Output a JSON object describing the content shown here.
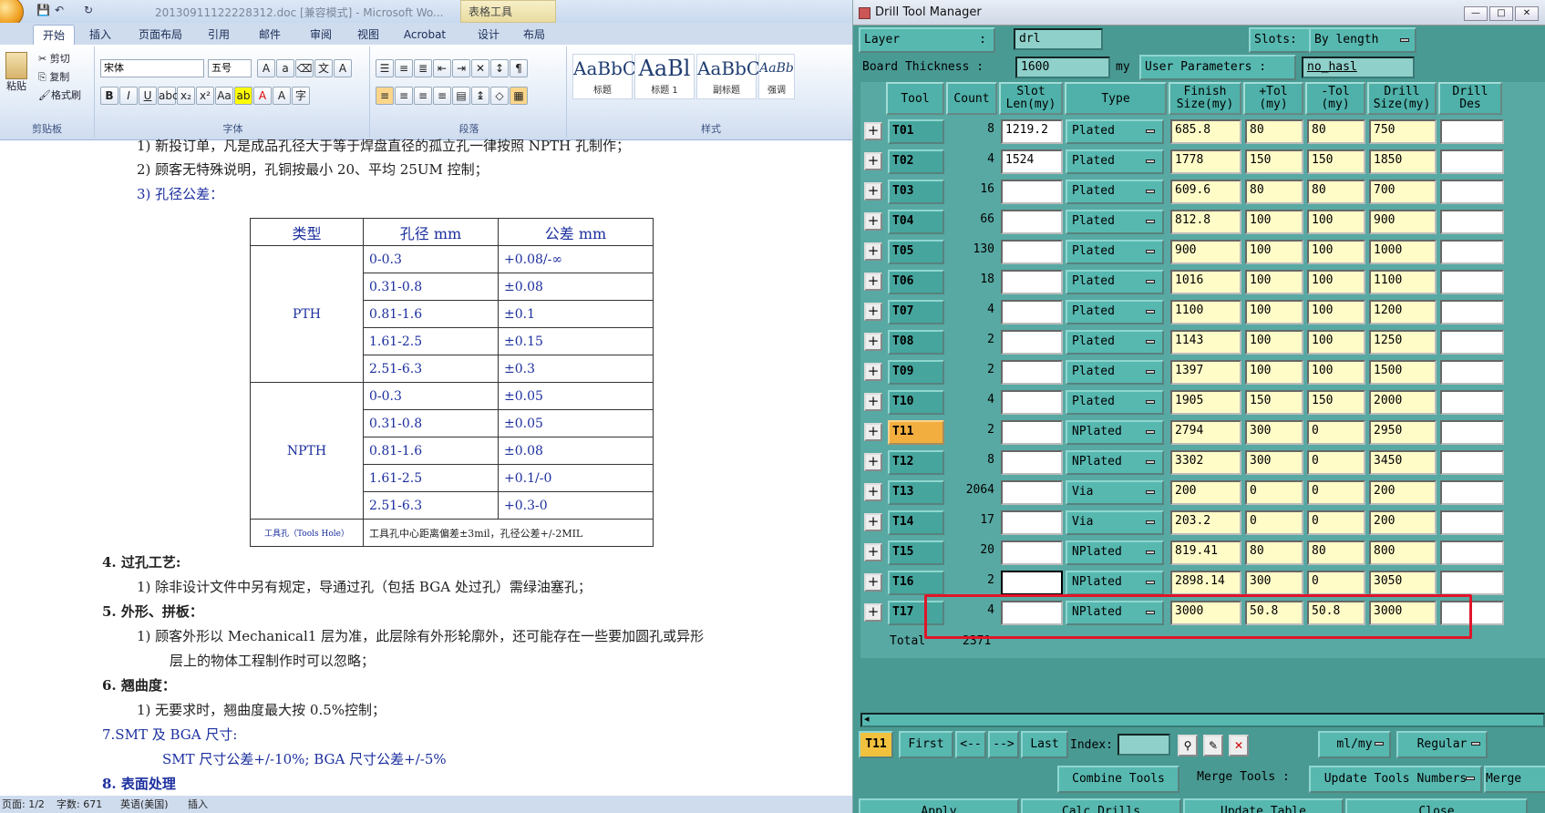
{
  "word": {
    "title": "20130911122228312.doc [兼容模式] - Microsoft Wo...",
    "context_tab": "表格工具",
    "tabs": [
      "开始",
      "插入",
      "页面布局",
      "引用",
      "邮件",
      "审阅",
      "视图",
      "Acrobat",
      "设计",
      "布局"
    ],
    "clipboard": {
      "paste": "粘贴",
      "cut": "剪切",
      "copy": "复制",
      "format": "格式刷",
      "label": "剪贴板"
    },
    "font": {
      "name": "宋体",
      "size": "五号",
      "label": "字体"
    },
    "paragraph_label": "段落",
    "styles": {
      "items": [
        {
          "sample": "AaBbC",
          "name": "标题"
        },
        {
          "sample": "AaBl",
          "name": "标题 1"
        },
        {
          "sample": "AaBbC",
          "name": "副标题"
        },
        {
          "sample": "AaBb",
          "name": "强调"
        }
      ],
      "label": "样式"
    },
    "lines": [
      "1)  新投订单，凡是成品孔径大于等于焊盘直径的孤立孔一律按照 NPTH 孔制作；",
      "2)  顾客无特殊说明，孔铜按最小 20、平均 25UM 控制；",
      "3)  孔径公差："
    ],
    "table": {
      "headers": [
        "类型",
        "孔径 mm",
        "公差 mm"
      ],
      "groups": [
        {
          "type": "PTH",
          "rows": [
            [
              "0-0.3",
              "+0.08/-∞"
            ],
            [
              "0.31-0.8",
              "±0.08"
            ],
            [
              "0.81-1.6",
              "±0.1"
            ],
            [
              "1.61-2.5",
              "±0.15"
            ],
            [
              "2.51-6.3",
              "±0.3"
            ]
          ]
        },
        {
          "type": "NPTH",
          "rows": [
            [
              "0-0.3",
              "±0.05"
            ],
            [
              "0.31-0.8",
              "±0.05"
            ],
            [
              "0.81-1.6",
              "±0.08"
            ],
            [
              "1.61-2.5",
              "+0.1/-0"
            ],
            [
              "2.51-6.3",
              "+0.3-0"
            ]
          ]
        }
      ],
      "tool_hole_label": "工具孔（Tools Hole）",
      "tool_hole_text": "工具孔中心距离偏差±3mil，孔径公差+/-2MIL"
    },
    "section4": "4.  过孔工艺:",
    "s4_1": "1)  除非设计文件中另有规定，导通过孔（包括 BGA 处过孔）需绿油塞孔；",
    "section5": "5.  外形、拼板：",
    "s5_1a": "1)  顾客外形以 Mechanical1 层为准，此层除有外形轮廓外，还可能存在一些要加圆孔或异形",
    "s5_1b": "层上的物体工程制作时可以忽略；",
    "section6": "6.  翘曲度：",
    "s6_1": "1)  无要求时，翘曲度最大按 0.5%控制；",
    "section7": "7.SMT 及 BGA 尺寸:",
    "s7_1": "SMT 尺寸公差+/-10%; BGA 尺寸公差+/-5%",
    "section8": "8.  表面处理",
    "status": {
      "page": "页面: 1/2",
      "words": "字数: 671",
      "lang": "英语(美国)",
      "mode": "插入"
    }
  },
  "dtm": {
    "title": "Drill Tool Manager",
    "layer_label": "Layer",
    "layer_value": "drl",
    "slots_label": "Slots:",
    "slots_value": "By length",
    "board_thickness_label": "Board Thickness :",
    "board_thickness_value": "1600",
    "board_unit": "my",
    "user_params_label": "User Parameters :",
    "user_params_value": "no_hasl",
    "columns": [
      "Tool",
      "Count",
      "Slot Len(my)",
      "Type",
      "Finish Size(my)",
      "+Tol (my)",
      "-Tol (my)",
      "Drill Size(my)",
      "Drill Des"
    ],
    "rows": [
      {
        "tool": "T01",
        "count": "8",
        "slot": "1219.2",
        "type": "Plated",
        "finish": "685.8",
        "ptol": "80",
        "ntol": "80",
        "drill": "750"
      },
      {
        "tool": "T02",
        "count": "4",
        "slot": "1524",
        "type": "Plated",
        "finish": "1778",
        "ptol": "150",
        "ntol": "150",
        "drill": "1850"
      },
      {
        "tool": "T03",
        "count": "16",
        "slot": "",
        "type": "Plated",
        "finish": "609.6",
        "ptol": "80",
        "ntol": "80",
        "drill": "700"
      },
      {
        "tool": "T04",
        "count": "66",
        "slot": "",
        "type": "Plated",
        "finish": "812.8",
        "ptol": "100",
        "ntol": "100",
        "drill": "900"
      },
      {
        "tool": "T05",
        "count": "130",
        "slot": "",
        "type": "Plated",
        "finish": "900",
        "ptol": "100",
        "ntol": "100",
        "drill": "1000"
      },
      {
        "tool": "T06",
        "count": "18",
        "slot": "",
        "type": "Plated",
        "finish": "1016",
        "ptol": "100",
        "ntol": "100",
        "drill": "1100"
      },
      {
        "tool": "T07",
        "count": "4",
        "slot": "",
        "type": "Plated",
        "finish": "1100",
        "ptol": "100",
        "ntol": "100",
        "drill": "1200"
      },
      {
        "tool": "T08",
        "count": "2",
        "slot": "",
        "type": "Plated",
        "finish": "1143",
        "ptol": "100",
        "ntol": "100",
        "drill": "1250"
      },
      {
        "tool": "T09",
        "count": "2",
        "slot": "",
        "type": "Plated",
        "finish": "1397",
        "ptol": "100",
        "ntol": "100",
        "drill": "1500"
      },
      {
        "tool": "T10",
        "count": "4",
        "slot": "",
        "type": "Plated",
        "finish": "1905",
        "ptol": "150",
        "ntol": "150",
        "drill": "2000"
      },
      {
        "tool": "T11",
        "count": "2",
        "slot": "",
        "type": "NPlated",
        "finish": "2794",
        "ptol": "300",
        "ntol": "0",
        "drill": "2950"
      },
      {
        "tool": "T12",
        "count": "8",
        "slot": "",
        "type": "NPlated",
        "finish": "3302",
        "ptol": "300",
        "ntol": "0",
        "drill": "3450"
      },
      {
        "tool": "T13",
        "count": "2064",
        "slot": "",
        "type": "Via",
        "finish": "200",
        "ptol": "0",
        "ntol": "0",
        "drill": "200"
      },
      {
        "tool": "T14",
        "count": "17",
        "slot": "",
        "type": "Via",
        "finish": "203.2",
        "ptol": "0",
        "ntol": "0",
        "drill": "200"
      },
      {
        "tool": "T15",
        "count": "20",
        "slot": "",
        "type": "NPlated",
        "finish": "819.41",
        "ptol": "80",
        "ntol": "80",
        "drill": "800"
      },
      {
        "tool": "T16",
        "count": "2",
        "slot": "",
        "type": "NPlated",
        "finish": "2898.14",
        "ptol": "300",
        "ntol": "0",
        "drill": "3050"
      },
      {
        "tool": "T17",
        "count": "4",
        "slot": "",
        "type": "NPlated",
        "finish": "3000",
        "ptol": "50.8",
        "ntol": "50.8",
        "drill": "3000"
      }
    ],
    "selected_tool": "T11",
    "total_label": "Total",
    "total_value": "2371",
    "nav": {
      "current": "T11",
      "first": "First",
      "prev": "<--",
      "next": "-->",
      "last": "Last",
      "index": "Index:",
      "units": "ml/my",
      "mode": "Regular"
    },
    "actions": {
      "combine": "Combine Tools",
      "merge": "Merge Tools :",
      "update_numbers": "Update Tools Numbers",
      "merge2": "Merge"
    },
    "bottom": {
      "apply": "Apply",
      "calc": "Calc Drills",
      "update_table": "Update Table",
      "close": "Close"
    },
    "highlight_color": "#e0152a"
  }
}
